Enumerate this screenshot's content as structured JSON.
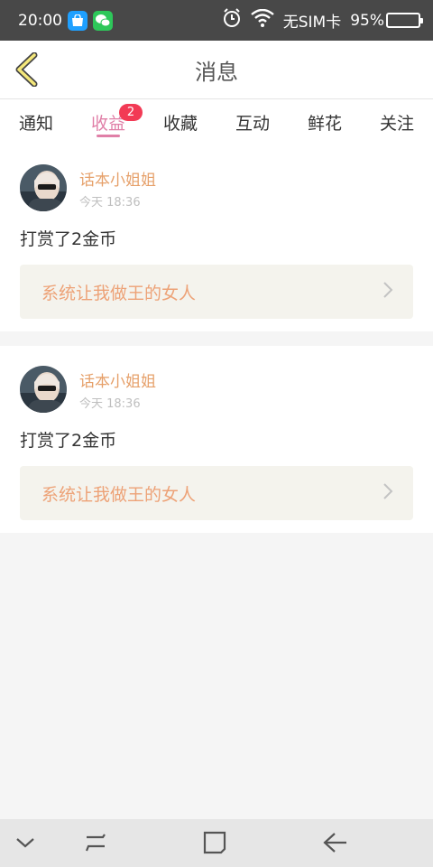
{
  "status_bar": {
    "time": "20:00",
    "carrier": "无SIM卡",
    "battery_text": "95%",
    "battery_level": 0.95,
    "icons": [
      "app-store-icon",
      "wechat-icon",
      "alarm-icon",
      "wifi-icon",
      "battery-icon"
    ]
  },
  "header": {
    "title": "消息",
    "back_icon": "chevron-left-icon"
  },
  "tabs": [
    {
      "label": "通知"
    },
    {
      "label": "收益",
      "badge": "2",
      "active": true
    },
    {
      "label": "收藏"
    },
    {
      "label": "互动"
    },
    {
      "label": "鲜花"
    },
    {
      "label": "关注"
    }
  ],
  "messages": [
    {
      "author": "话本小姐姐",
      "time": "今天 18:36",
      "text": "打赏了2金币",
      "book_title": "系统让我做王的女人"
    },
    {
      "author": "话本小姐姐",
      "time": "今天 18:36",
      "text": "打赏了2金币",
      "book_title": "系统让我做王的女人"
    }
  ],
  "nav_bar": {
    "icons": [
      "collapse-icon",
      "menu-icon",
      "home-icon",
      "back-icon"
    ]
  },
  "colors": {
    "accent": "#e07fa7",
    "author": "#e6a06a",
    "badge": "#f23a55",
    "book_link_text": "#eda277",
    "status_bar": "#484848"
  }
}
